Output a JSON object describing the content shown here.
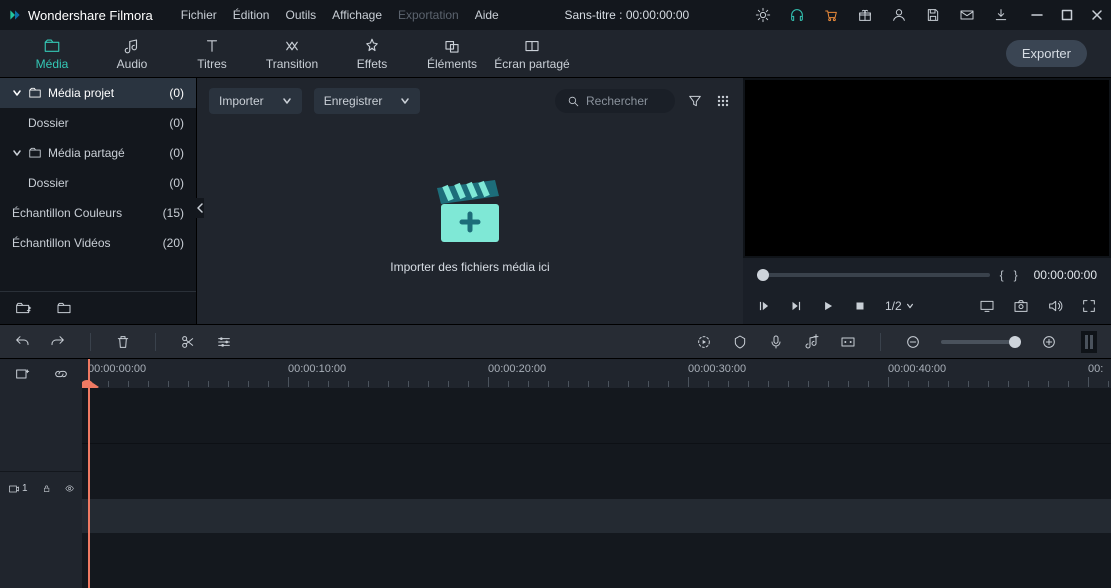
{
  "app": {
    "name": "Wondershare Filmora"
  },
  "menu": {
    "file": "Fichier",
    "edit": "Édition",
    "tools": "Outils",
    "view": "Affichage",
    "export": "Exportation",
    "help": "Aide"
  },
  "title_center": "Sans-titre : 00:00:00:00",
  "tabs": {
    "media": "Média",
    "audio": "Audio",
    "titles": "Titres",
    "transition": "Transition",
    "effects": "Effets",
    "elements": "Éléments",
    "split": "Écran partagé"
  },
  "export_button": "Exporter",
  "sidebar": {
    "items": [
      {
        "label": "Média projet",
        "count": "(0)"
      },
      {
        "label": "Dossier",
        "count": "(0)"
      },
      {
        "label": "Média partagé",
        "count": "(0)"
      },
      {
        "label": "Dossier",
        "count": "(0)"
      },
      {
        "label": "Échantillon Couleurs",
        "count": "(15)"
      },
      {
        "label": "Échantillon Vidéos",
        "count": "(20)"
      }
    ]
  },
  "media_toolbar": {
    "import": "Importer",
    "record": "Enregistrer",
    "search_placeholder": "Rechercher"
  },
  "media_empty_text": "Importer des fichiers média ici",
  "preview": {
    "timecode": "00:00:00:00",
    "ratio": "1/2"
  },
  "ruler": {
    "labels": [
      "00:00:00:00",
      "00:00:10:00",
      "00:00:20:00",
      "00:00:30:00",
      "00:00:40:00",
      "00:"
    ]
  },
  "track_head": {
    "badge": "1"
  }
}
